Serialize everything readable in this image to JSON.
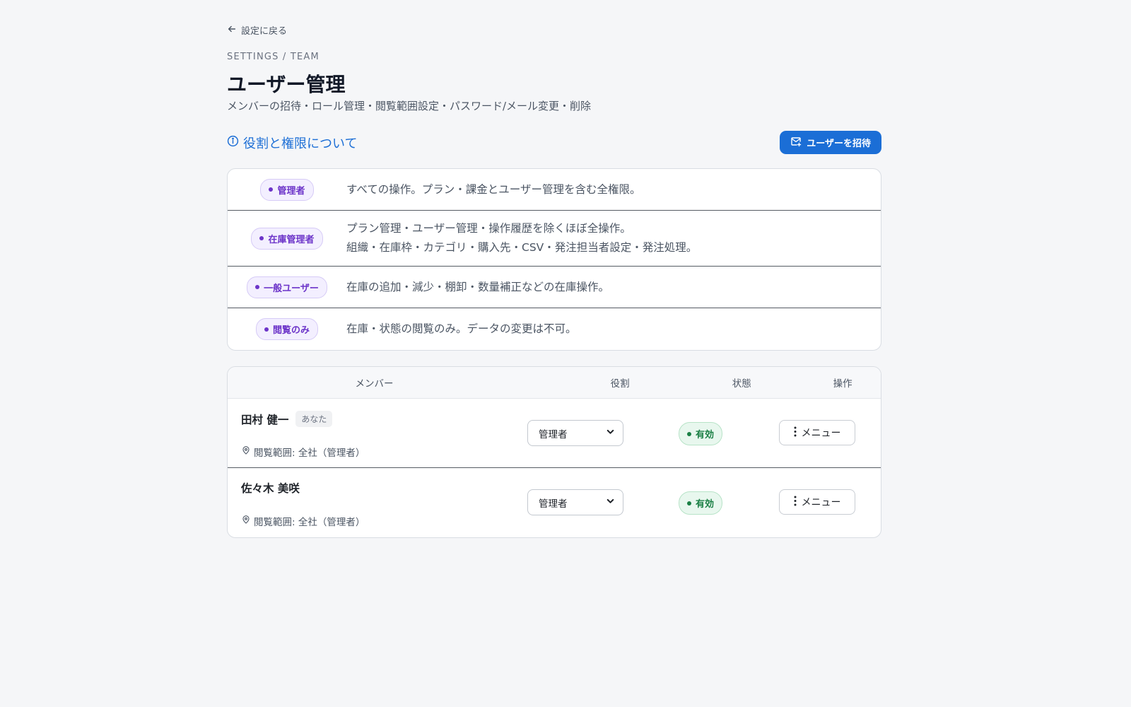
{
  "nav": {
    "back_label": "設定に戻る"
  },
  "header": {
    "eyebrow": "SETTINGS / TEAM",
    "title": "ユーザー管理",
    "subtitle": "メンバーの招待・ロール管理・閲覧範囲設定・パスワード/メール変更・削除"
  },
  "roles_info": {
    "link_label": "役割と権限について",
    "invite_button_label": "ユーザーを招待",
    "roles": [
      {
        "name": "管理者",
        "desc": [
          "すべての操作。プラン・課金とユーザー管理を含む全権限。"
        ]
      },
      {
        "name": "在庫管理者",
        "desc": [
          "プラン管理・ユーザー管理・操作履歴を除くほぼ全操作。",
          "組織・在庫枠・カテゴリ・購入先・CSV・発注担当者設定・発注処理。"
        ]
      },
      {
        "name": "一般ユーザー",
        "desc": [
          "在庫の追加・減少・棚卸・数量補正などの在庫操作。"
        ]
      },
      {
        "name": "閲覧のみ",
        "desc": [
          "在庫・状態の閲覧のみ。データの変更は不可。"
        ]
      }
    ]
  },
  "members_table": {
    "columns": {
      "member": "メンバー",
      "role": "役割",
      "status": "状態",
      "actions": "操作"
    },
    "rows": [
      {
        "name": "田村 健一",
        "you_badge": "あなた",
        "scope": "閲覧範囲: 全社（管理者）",
        "role": "管理者",
        "status": "有効",
        "menu_label": "メニュー"
      },
      {
        "name": "佐々木 美咲",
        "you_badge": "",
        "scope": "閲覧範囲: 全社（管理者）",
        "role": "管理者",
        "status": "有効",
        "menu_label": "メニュー"
      }
    ]
  },
  "colors": {
    "accent": "#1b6ed6",
    "role_badge": "#6c34c9",
    "status_active": "#1a7f44"
  },
  "icons": {
    "back": "arrow-left-icon",
    "info": "info-circle-icon",
    "invite": "mail-plus-icon",
    "scope": "map-pin-icon",
    "select": "chevron-down-icon",
    "menu": "more-vertical-icon"
  }
}
